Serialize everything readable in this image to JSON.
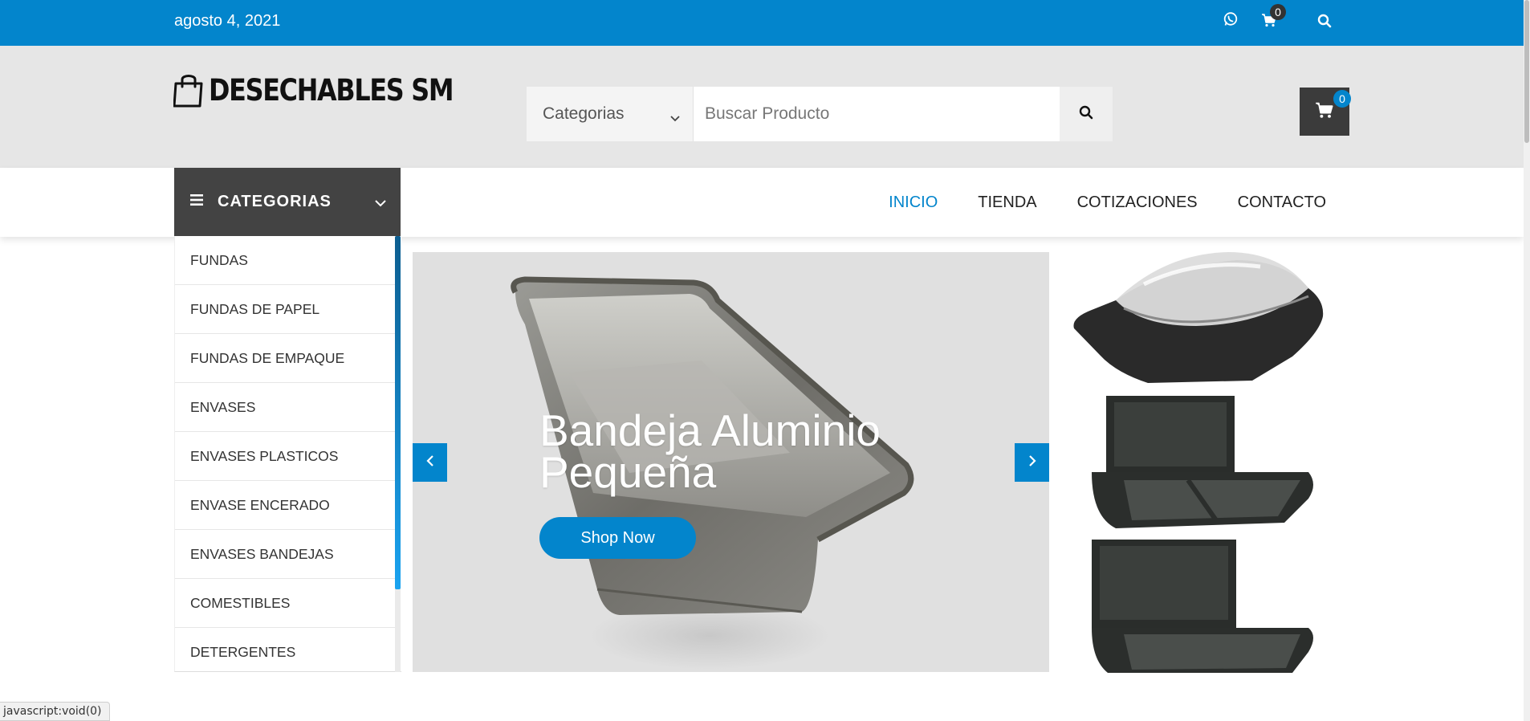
{
  "topbar": {
    "date": "agosto 4, 2021",
    "cart_count": "0",
    "icons": [
      "whatsapp-icon",
      "cart-icon",
      "search-icon"
    ]
  },
  "header": {
    "logo_text": "DESECHABLES SM",
    "search": {
      "category_label": "Categorias",
      "placeholder": "Buscar Producto"
    },
    "cart_count": "0"
  },
  "nav": {
    "categories_label": "CATEGORIAS",
    "menu": [
      "INICIO",
      "TIENDA",
      "COTIZACIONES",
      "CONTACTO"
    ],
    "active": "INICIO"
  },
  "categories": [
    "FUNDAS",
    "FUNDAS DE PAPEL",
    "FUNDAS DE EMPAQUE",
    "ENVASES",
    "ENVASES PLASTICOS",
    "ENVASE ENCERADO",
    "ENVASES BANDEJAS",
    "COMESTIBLES",
    "DETERGENTES"
  ],
  "slider": {
    "title": "Bandeja Aluminio Pequeña",
    "button": "Shop Now"
  },
  "statusbar": {
    "text": "javascript:void(0)"
  },
  "colors": {
    "accent": "#0385cc",
    "dark": "#434343",
    "header_bg": "#e6e6e6"
  }
}
